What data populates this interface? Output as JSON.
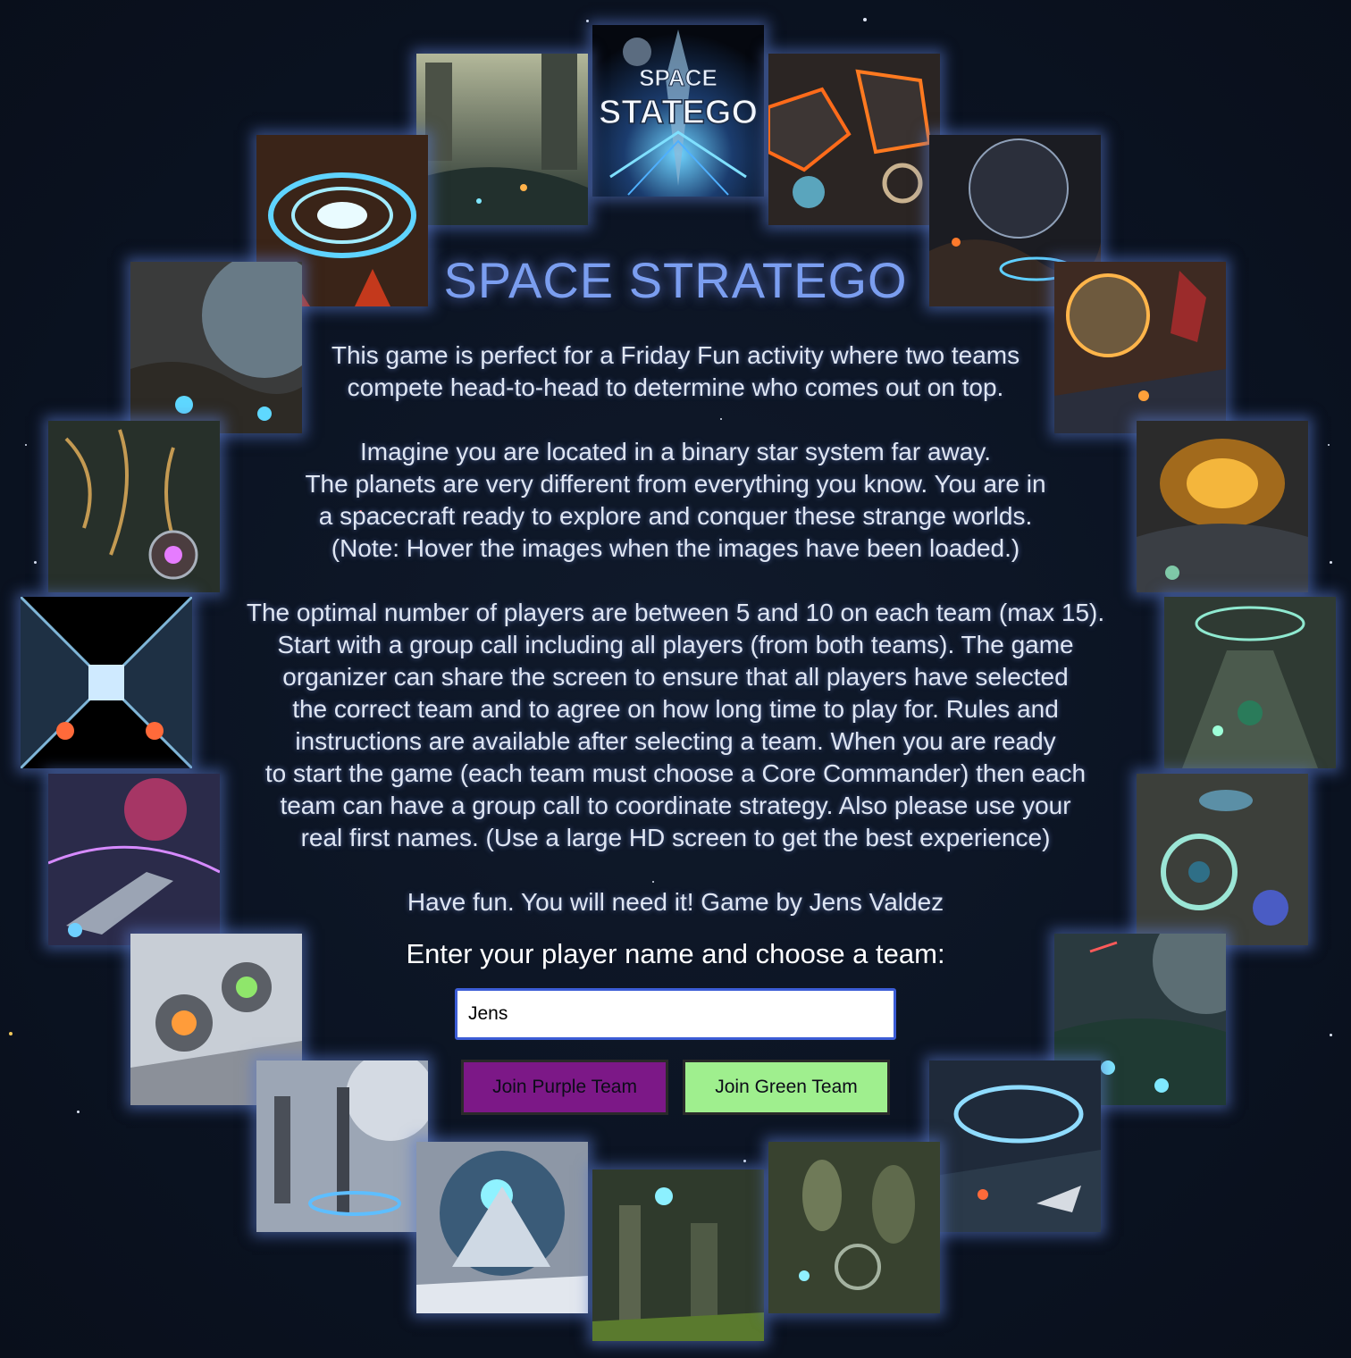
{
  "title": "SPACE STRATEGO",
  "paragraphs": {
    "intro_1": "This game is perfect for a Friday Fun activity where two teams",
    "intro_2": "compete head-to-head to determine who comes out on top.",
    "setting_1": "Imagine you are located in a binary star system far away.",
    "setting_2": "The planets are very different from everything you know. You are in",
    "setting_3": "a spacecraft ready to explore and conquer these strange worlds.",
    "setting_4": "(Note: Hover the images when the images have been loaded.)",
    "rules_1": "The optimal number of players are between 5 and 10 on each team (max 15).",
    "rules_2": "Start with a group call including all players (from both teams). The game",
    "rules_3": "organizer can share the screen to ensure that all players have selected",
    "rules_4": "the correct team and to agree on how long time to play for. Rules and",
    "rules_5": "instructions are available after selecting a team. When you are ready",
    "rules_6": "to start the game (each team must choose a Core Commander) then each",
    "rules_7": "team can have a group call to coordinate strategy. Also please use your",
    "rules_8": "real first names. (Use a large HD screen to get the best experience)",
    "closing": "Have fun. You will need it! Game by Jens Valdez"
  },
  "form": {
    "prompt": "Enter your player name and choose a team:",
    "name_value": "Jens",
    "purple_button": "Join Purple Team",
    "green_button": "Join Green Team"
  },
  "logo_tile": {
    "line1": "SPACE",
    "line2": "STATEGO"
  },
  "colors": {
    "background": "#0b1220",
    "title": "#7b9ef0",
    "purple_team": "#7c1887",
    "green_team": "#9fef8e",
    "tile_glow": "#5a78c8"
  }
}
